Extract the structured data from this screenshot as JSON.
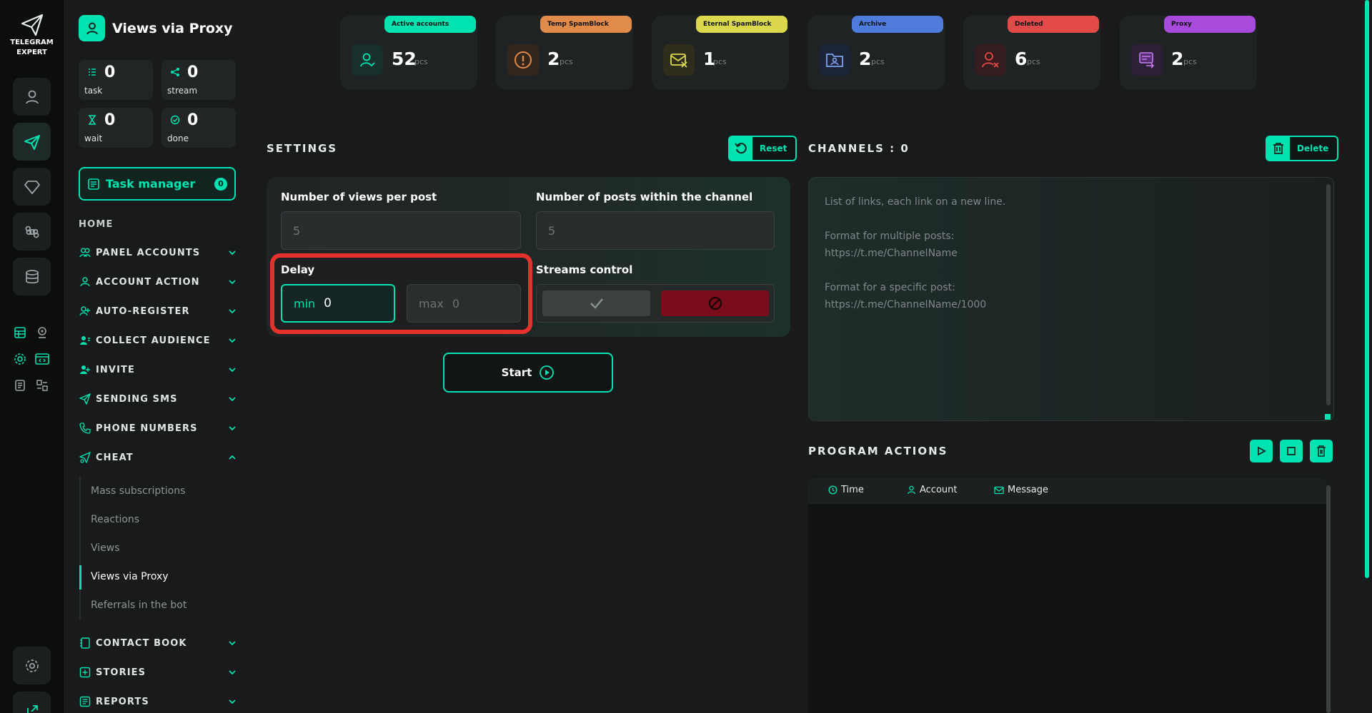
{
  "app": {
    "logo_line1": "TELEGRAM",
    "logo_line2": "EXPERT"
  },
  "rail": {
    "icons": [
      "user-icon",
      "send-icon",
      "diamond-icon",
      "command-icon",
      "database-icon",
      "settings-icon",
      "external-link-icon"
    ]
  },
  "sidebar": {
    "title": "Views via Proxy",
    "stats": [
      {
        "value": "0",
        "label": "task"
      },
      {
        "value": "0",
        "label": "stream"
      },
      {
        "value": "0",
        "label": "wait"
      },
      {
        "value": "0",
        "label": "done"
      }
    ],
    "task_manager": {
      "label": "Task manager",
      "badge": "0"
    },
    "home": "HOME",
    "menu": [
      {
        "label": "PANEL ACCOUNTS",
        "icon": "users-icon",
        "state": "collapsed"
      },
      {
        "label": "ACCOUNT ACTION",
        "icon": "user-icon",
        "state": "collapsed"
      },
      {
        "label": "AUTO-REGISTER",
        "icon": "user-plus-icon",
        "state": "collapsed"
      },
      {
        "label": "COLLECT AUDIENCE",
        "icon": "audience-icon",
        "state": "collapsed"
      },
      {
        "label": "INVITE",
        "icon": "invite-icon",
        "state": "collapsed"
      },
      {
        "label": "SENDING SMS",
        "icon": "send-icon",
        "state": "collapsed"
      },
      {
        "label": "PHONE NUMBERS",
        "icon": "phone-icon",
        "state": "collapsed"
      },
      {
        "label": "CHEAT",
        "icon": "cheat-icon",
        "state": "expanded"
      },
      {
        "label": "CONTACT BOOK",
        "icon": "book-icon",
        "state": "collapsed"
      },
      {
        "label": "STORIES",
        "icon": "plus-square-icon",
        "state": "collapsed"
      },
      {
        "label": "REPORTS",
        "icon": "report-icon",
        "state": "collapsed"
      }
    ],
    "cheat_sub": [
      {
        "label": "Mass subscriptions"
      },
      {
        "label": "Reactions"
      },
      {
        "label": "Views"
      },
      {
        "label": "Views via Proxy",
        "active": true
      },
      {
        "label": "Referrals in the bot"
      }
    ]
  },
  "counters": [
    {
      "label": "Active accounts",
      "value": "52",
      "unit": "pcs",
      "color": "#00e3b0",
      "icon": "active-user-icon"
    },
    {
      "label": "Temp SpamBlock",
      "value": "2",
      "unit": "pcs",
      "color": "#e08b4a",
      "icon": "warning-icon"
    },
    {
      "label": "Eternal SpamBlock",
      "value": "1",
      "unit": "pcs",
      "color": "#dcd84e",
      "icon": "mail-block-icon"
    },
    {
      "label": "Archive",
      "value": "2",
      "unit": "pcs",
      "color": "#4f7cdc",
      "icon": "archive-icon"
    },
    {
      "label": "Deleted",
      "value": "6",
      "unit": "pcs",
      "color": "#e24a4a",
      "icon": "deleted-user-icon"
    },
    {
      "label": "Proxy",
      "value": "2",
      "unit": "pcs",
      "color": "#a84bdc",
      "icon": "proxy-icon"
    }
  ],
  "settings": {
    "title": "SETTINGS",
    "reset_label": "Reset",
    "views_per_post": {
      "label": "Number of views per post",
      "placeholder": "5"
    },
    "posts_in_channel": {
      "label": "Number of posts within the channel",
      "placeholder": "5"
    },
    "delay": {
      "label": "Delay",
      "min_prefix": "min",
      "min_value": "0",
      "max_prefix": "max",
      "max_placeholder": "0"
    },
    "streams": {
      "label": "Streams control"
    },
    "start_label": "Start"
  },
  "channels": {
    "title": "CHANNELS : 0",
    "delete_label": "Delete",
    "hint_lines": [
      "List of links, each link on a new line.",
      "",
      "Format for multiple posts:",
      "https://t.me/ChannelName",
      "",
      "Format for a specific post:",
      "https://t.me/ChannelName/1000"
    ]
  },
  "program_actions": {
    "title": "PROGRAM ACTIONS",
    "columns": [
      {
        "label": "Time",
        "icon": "clock-icon"
      },
      {
        "label": "Account",
        "icon": "user-icon"
      },
      {
        "label": "Message",
        "icon": "mail-icon"
      }
    ]
  }
}
